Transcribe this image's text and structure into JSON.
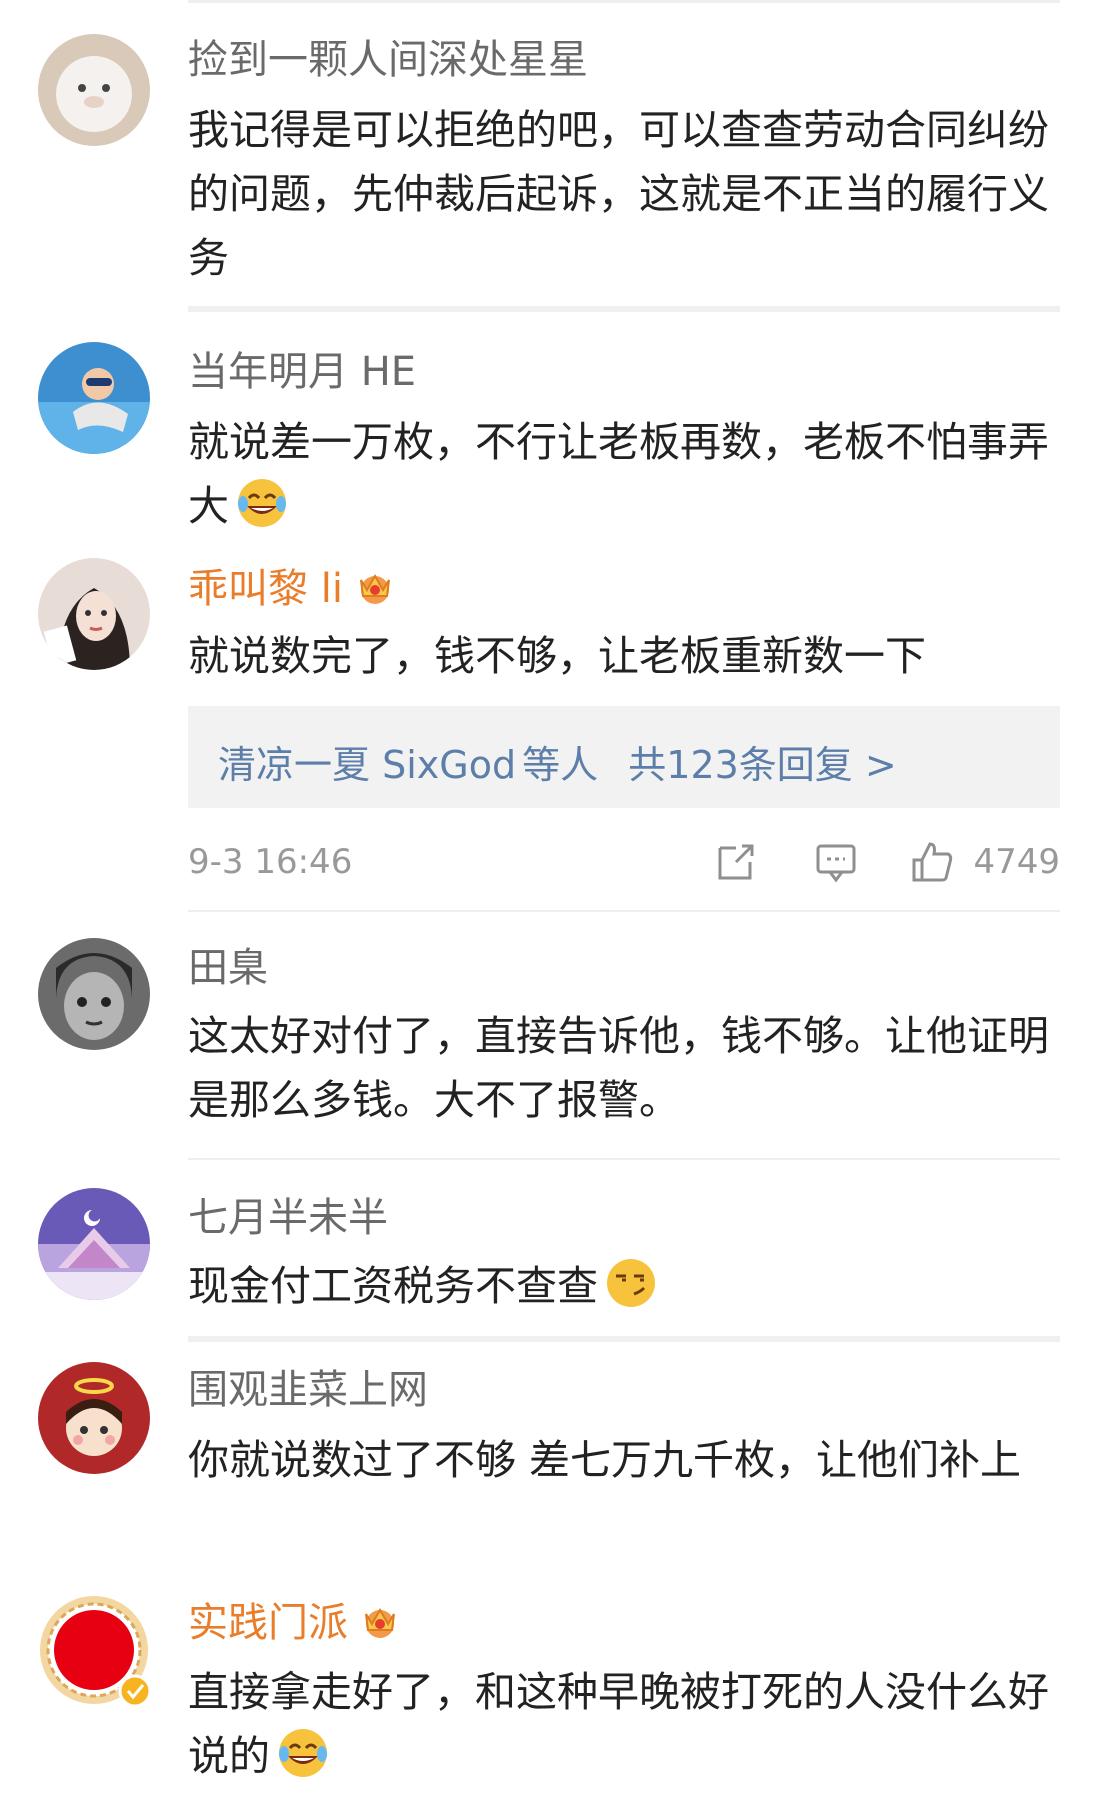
{
  "comments": [
    {
      "user": "捡到一颗人间深处星星",
      "text": "我记得是可以拒绝的吧，可以查查劳动合同纠纷的问题，先仲裁后起诉，这就是不正当的履行义务"
    },
    {
      "user": "当年明月 HE",
      "text": "就说差一万枚，不行让老板再数，老板不怕事弄大",
      "emoji": "laugh-cry-emoji"
    },
    {
      "user": "乖叫黎 li",
      "text": "就说数完了，钱不够，让老板重新数一下",
      "vip": true
    },
    {
      "user": "田臬",
      "text": "这太好对付了，直接告诉他，钱不够。让他证明是那么多钱。大不了报警。"
    },
    {
      "user": "七月半未半",
      "text": "现金付工资税务不查查",
      "emoji": "smirk-emoji"
    },
    {
      "user": "围观韭菜上网",
      "text": "你就说数过了不够 差七万九千枚，让他们补上"
    },
    {
      "user": "实践门派",
      "text": "直接拿走好了，和这种早晚被打死的人没什么好说的",
      "vip": true,
      "emoji": "laugh-cry-emoji"
    }
  ],
  "reply_summary": {
    "names": "清凉一夏 SixGod",
    "suffix": "等人",
    "count_text": "共123条回复 >"
  },
  "meta": {
    "time": "9-3 16:46",
    "likes": "4749",
    "share_icon": "share-icon",
    "comment_icon": "comment-icon",
    "like_icon": "thumbs-up-icon"
  },
  "colors": {
    "username": "#6a6a6a",
    "vip_username": "#ea7d2a",
    "reply_link": "#5c7ea8",
    "text": "#222222"
  }
}
